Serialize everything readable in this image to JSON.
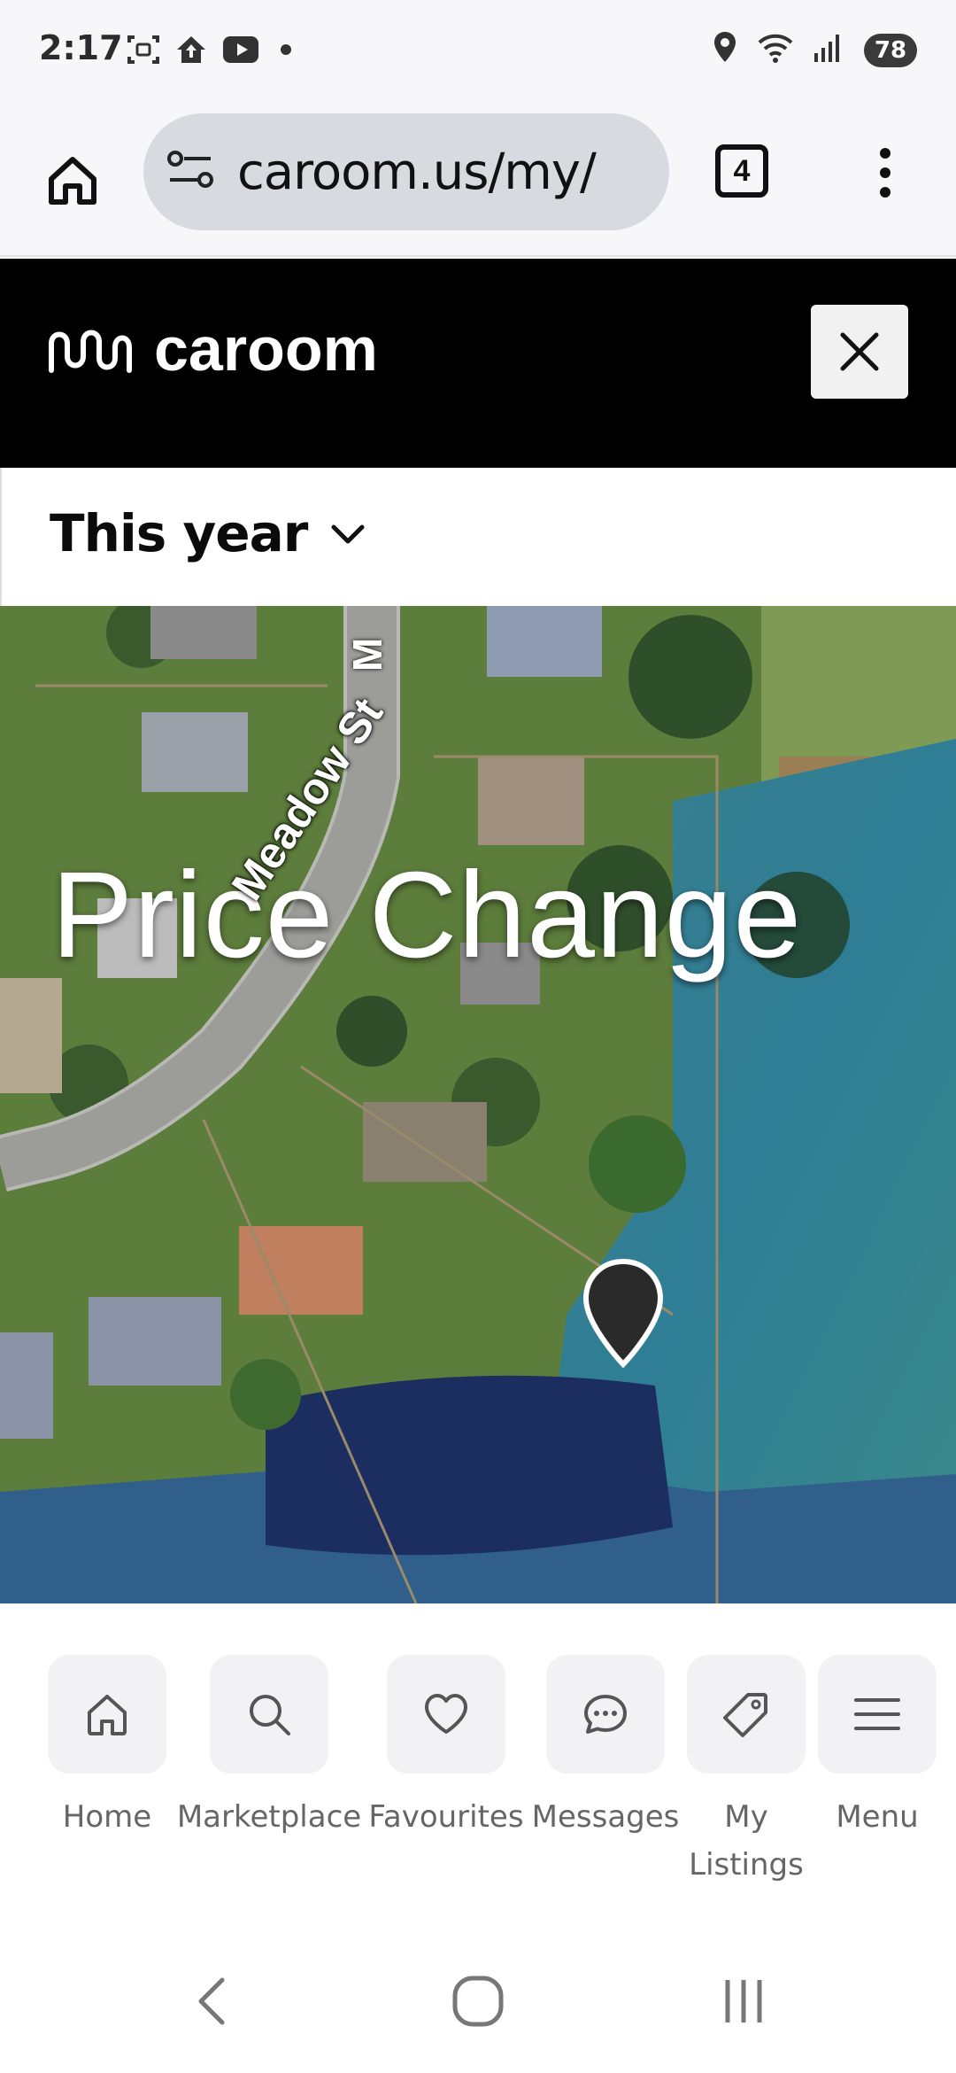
{
  "status_bar": {
    "time": "2:17",
    "battery": "78",
    "icons_left": [
      "screenshot-icon",
      "home-upload-icon",
      "youtube-icon",
      "dot-icon"
    ],
    "icons_right": [
      "location-icon",
      "wifi-icon",
      "signal-icon",
      "battery-icon"
    ]
  },
  "browser": {
    "url": "caroom.us/my/",
    "tab_count": "4"
  },
  "site": {
    "logo_text": "caroom"
  },
  "filter": {
    "period_label": "This year"
  },
  "map": {
    "overlay_title": "Price Change",
    "street_name": "Meadow St",
    "street_fragment": "M"
  },
  "bottom_nav": {
    "items": [
      {
        "label": "Home",
        "icon": "home-icon"
      },
      {
        "label": "Marketplace",
        "icon": "search-icon"
      },
      {
        "label": "Favourites",
        "icon": "heart-icon"
      },
      {
        "label": "Messages",
        "icon": "chat-icon"
      },
      {
        "label": "My Listings",
        "icon": "tag-icon"
      },
      {
        "label": "Menu",
        "icon": "menu-icon"
      }
    ]
  },
  "android_nav": [
    "back-icon",
    "home-circle-icon",
    "recents-icon"
  ],
  "colors": {
    "header_bg": "#000000",
    "pill_bg": "#d9dae0",
    "nav_icon_bg": "#f2f2f4",
    "nav_label": "#666666",
    "pin": "#2a2a2a"
  }
}
